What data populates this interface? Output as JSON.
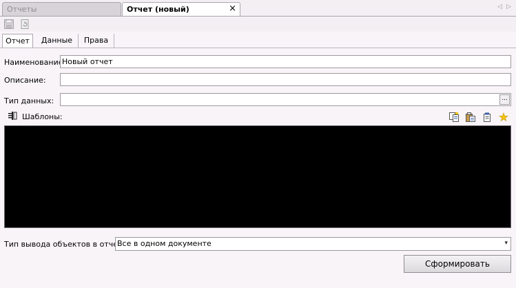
{
  "doc_tabs": [
    {
      "label": "Отчеты",
      "active": false
    },
    {
      "label": "Отчет (новый)",
      "active": true
    }
  ],
  "icons": {
    "close": "×",
    "arrow_left": "◁",
    "arrow_right": "▷",
    "ellipsis": "...",
    "dropdown": "▾",
    "save": "save-icon",
    "refresh": "refresh-icon",
    "templates": "templates-icon",
    "copy": "copy-icon",
    "paste": "paste-icon",
    "properties": "properties-icon",
    "new": "star-icon"
  },
  "inner_tabs": [
    {
      "label": "Отчет",
      "active": true
    },
    {
      "label": "Данные",
      "active": false
    },
    {
      "label": "Права",
      "active": false
    }
  ],
  "form": {
    "name_label": "Наименование:",
    "name_value": "Новый отчет",
    "description_label": "Описание:",
    "description_value": "",
    "datatype_label": "Тип данных:",
    "datatype_value": "",
    "templates_label": "Шаблоны:",
    "output_type_label": "Тип вывода объектов в отчет:",
    "output_type_value": "Все в одном документе",
    "run_button": "Сформировать"
  },
  "colors": {
    "background": "#f8f4f8",
    "editor_bg": "#000000",
    "accent_yellow": "#f2c311"
  }
}
